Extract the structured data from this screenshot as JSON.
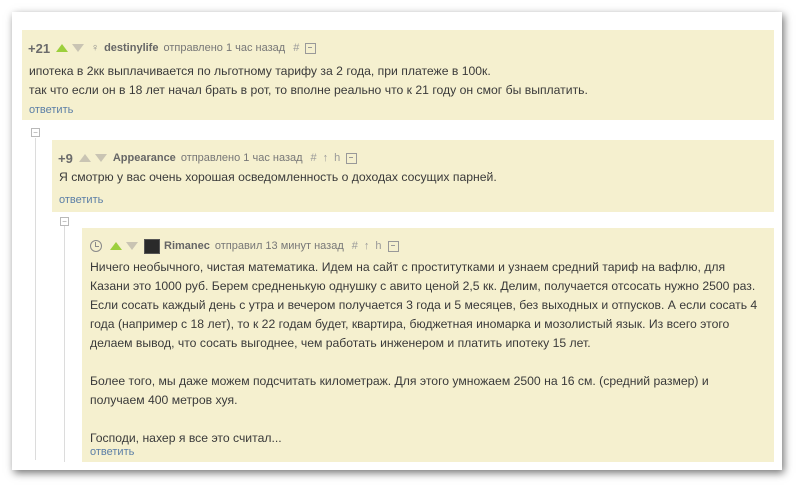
{
  "colors": {
    "comment_bg": "#f5f0cf",
    "upvote": "#9ccf3c",
    "link": "#5b7ea6"
  },
  "comments": [
    {
      "rating": "+21",
      "author": "destinylife",
      "meta": "отправлено 1 час назад",
      "hash": "#",
      "body": [
        "ипотека в 2кк выплачивается по льготному тарифу за 2 года, при платеже в 100к.",
        "так что если он в 18 лет начал брать в рот, то вполне реально что к 21 году он смог бы выплатить."
      ],
      "reply": "ответить"
    },
    {
      "rating": "+9",
      "author": "Appearance",
      "meta": "отправлено 1 час назад",
      "hash": "#",
      "up": "↑",
      "branch": "h",
      "body": [
        "Я смотрю у вас очень хорошая осведомленность о доходах сосущих парней."
      ],
      "reply": "ответить"
    },
    {
      "author": "Rimanec",
      "meta": "отправил 13 минут назад",
      "hash": "#",
      "up": "↑",
      "branch": "h",
      "paragraph1": "Ничего необычного, чистая математика. Идем на сайт с проститутками и узнаем средний тариф на вафлю, для Казани это 1000 руб. Берем средненькую однушку с авито ценой 2,5 кк. Делим, получается отсосать нужно 2500 раз. Если сосать каждый день с утра и вечером получается 3 года и 5 месяцев, без выходных и отпусков. А если сосать 4 года (например с 18 лет), то к 22 годам будет, квартира, бюджетная иномарка и мозолистый язык. Из всего этого делаем вывод, что сосать выгоднее, чем работать инженером и платить ипотеку 15 лет.",
      "paragraph2": "Более того, мы даже можем подсчитать километраж. Для этого умножаем 2500 на 16 см. (средний размер) и получаем 400 метров хуя.",
      "paragraph3": "Господи, нахер я все это считал...",
      "reply": "ответить"
    }
  ],
  "collapse_symbol": "−"
}
